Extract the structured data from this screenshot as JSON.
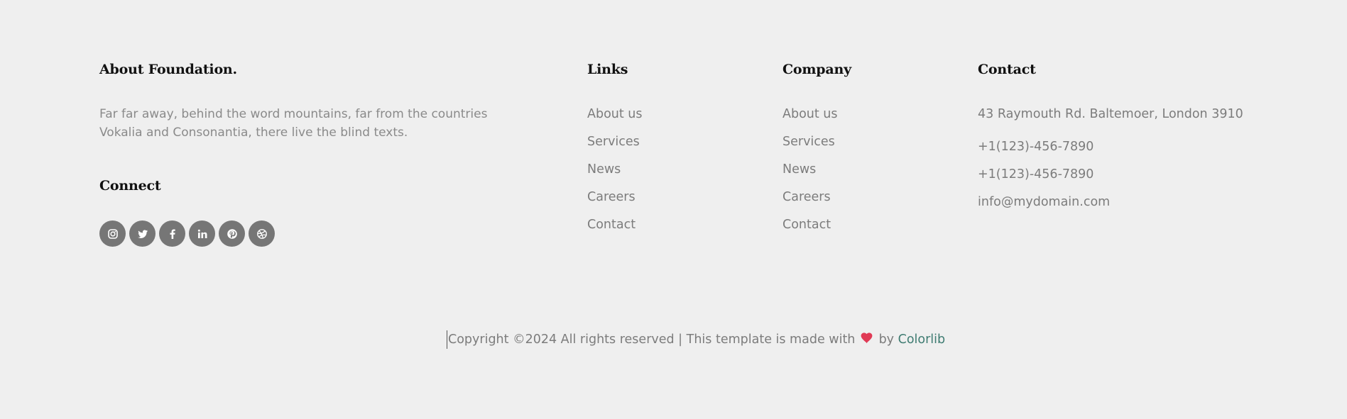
{
  "about": {
    "heading": "About Foundation.",
    "text": "Far far away, behind the word mountains, far from the countries Vokalia and Consonantia, there live the blind texts.",
    "connect_heading": "Connect",
    "social_icons": [
      "instagram-icon",
      "twitter-icon",
      "facebook-icon",
      "linkedin-icon",
      "pinterest-icon",
      "dribbble-icon"
    ],
    "social_bg": "#767676"
  },
  "links": {
    "heading": "Links",
    "items": [
      {
        "label": "About us"
      },
      {
        "label": "Services"
      },
      {
        "label": "News"
      },
      {
        "label": "Careers"
      },
      {
        "label": "Contact"
      }
    ]
  },
  "company": {
    "heading": "Company",
    "items": [
      {
        "label": "About us"
      },
      {
        "label": "Services"
      },
      {
        "label": "News"
      },
      {
        "label": "Careers"
      },
      {
        "label": "Contact"
      }
    ]
  },
  "contact": {
    "heading": "Contact",
    "address": "43 Raymouth Rd. Baltemoer, London 3910",
    "phone1": "+1(123)-456-7890",
    "phone2": "+1(123)-456-7890",
    "email": "info@mydomain.com"
  },
  "copyright": {
    "prefix": "Copyright ©2024 All rights reserved | This template is made with",
    "by": "by",
    "link": "Colorlib",
    "heart_color": "#e03a55",
    "link_color": "#3f7c72"
  },
  "colors": {
    "background": "#efefef",
    "heading": "#111111",
    "text": "#7c7c7c"
  }
}
